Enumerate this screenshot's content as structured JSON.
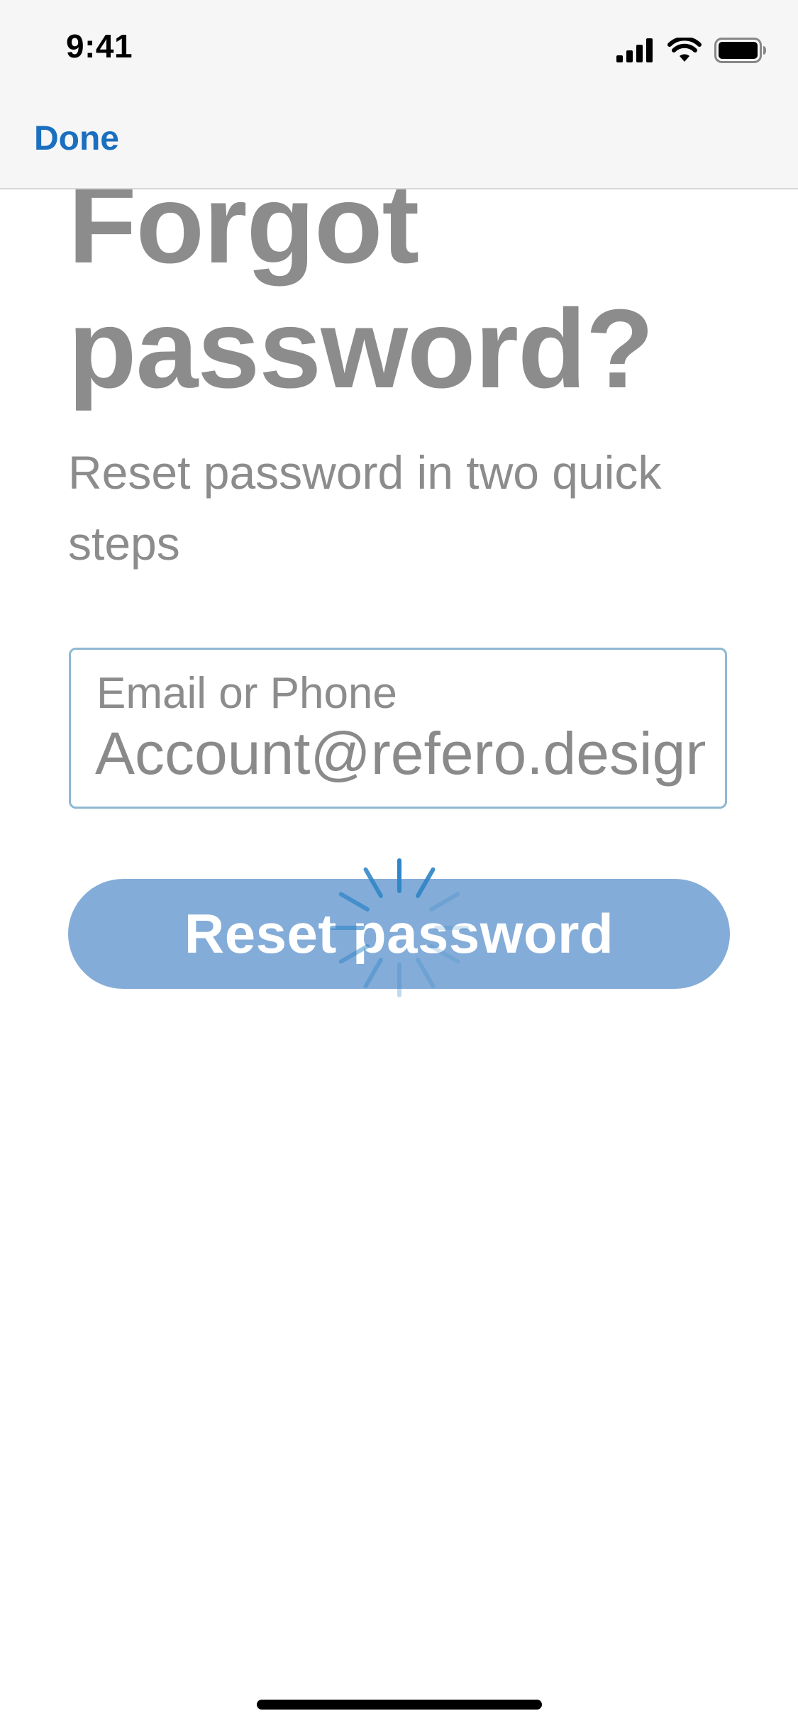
{
  "status_bar": {
    "time": "9:41",
    "icons": [
      "cellular-signal-icon",
      "wifi-icon",
      "battery-icon"
    ]
  },
  "nav": {
    "done_label": "Done"
  },
  "content": {
    "title_line1": "Forgot",
    "title_line2": "password?",
    "subtitle_line1": "Reset password in two quick",
    "subtitle_line2": "steps"
  },
  "form": {
    "field_label": "Email or Phone",
    "field_value": "Account@refero.design"
  },
  "button": {
    "label": "Reset password",
    "state": "loading"
  },
  "colors": {
    "accent": "#1a6fbf",
    "button_bg": "#84acd8",
    "field_border": "#8fb8d3",
    "muted_text": "#8c8c8c",
    "spinner": "#2f86c8"
  }
}
